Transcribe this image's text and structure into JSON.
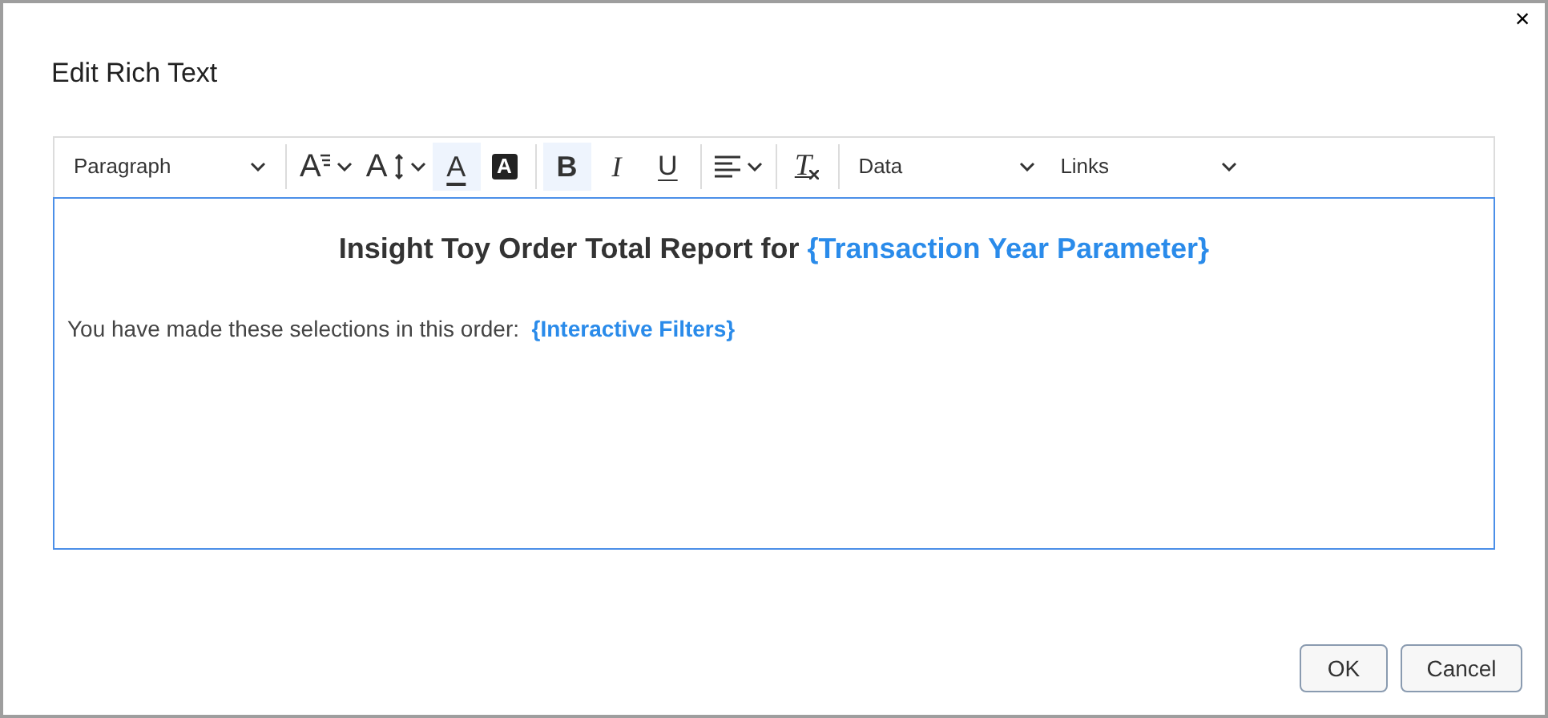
{
  "dialog": {
    "title": "Edit Rich Text",
    "close": "×"
  },
  "toolbar": [
    {
      "items": [
        {
          "kind": "select",
          "label": "Paragraph"
        }
      ]
    },
    {
      "items": [
        {
          "kind": "font-size",
          "glyph": "A",
          "selected": false
        },
        {
          "kind": "line-height",
          "glyph": "A",
          "selected": false
        },
        {
          "kind": "font-color",
          "glyph": "A",
          "selected": true
        },
        {
          "kind": "highlight",
          "glyph": "A",
          "selected": false
        }
      ]
    },
    {
      "items": [
        {
          "kind": "bold",
          "glyph": "B",
          "selected": true
        },
        {
          "kind": "italic",
          "glyph": "I",
          "selected": false
        },
        {
          "kind": "underline",
          "glyph": "U",
          "selected": false
        }
      ]
    },
    {
      "items": [
        {
          "kind": "align",
          "selected": false
        }
      ]
    },
    {
      "items": [
        {
          "kind": "clear",
          "glyph": "T",
          "selected": false
        }
      ]
    },
    {
      "items": [
        {
          "kind": "select",
          "label": "Data"
        },
        {
          "kind": "select",
          "label": "Links"
        }
      ]
    }
  ],
  "editor": {
    "heading": [
      {
        "kind": "text",
        "text": "Insight Toy Order Total Report for "
      },
      {
        "kind": "field",
        "text": "{Transaction Year Parameter}"
      }
    ],
    "paragraph": [
      {
        "kind": "text",
        "text": "You have made these selections in this order:  "
      },
      {
        "kind": "field",
        "text": "{Interactive Filters}"
      }
    ]
  },
  "buttons": [
    "OK",
    "Cancel"
  ]
}
